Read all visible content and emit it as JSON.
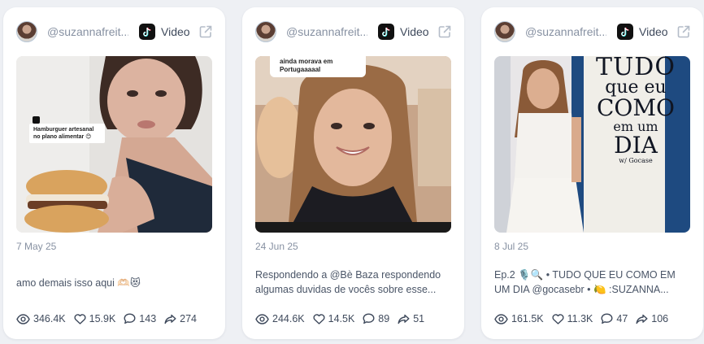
{
  "posts": [
    {
      "username": "@suzannafreit...",
      "platform": "Video",
      "date": "7 May 25",
      "description": "amo demais isso aqui 🫶🏻😻",
      "overlay_text": "Hamburguer artesanal no plano alimentar 😊",
      "stats": {
        "views": "346.4K",
        "likes": "15.9K",
        "comments": "143",
        "shares": "274"
      }
    },
    {
      "username": "@suzannafreit...",
      "platform": "Video",
      "date": "24 Jun 25",
      "description": "Respondendo a @Bè Baza respondendo algumas duvidas de vocês sobre esse...",
      "overlay_text": "ainda morava em Portugaaaaal",
      "stats": {
        "views": "244.6K",
        "likes": "14.5K",
        "comments": "89",
        "shares": "51"
      }
    },
    {
      "username": "@suzannafreit...",
      "platform": "Video",
      "date": "8 Jul 25",
      "description": "Ep.2 🎙️🔍 • TUDO QUE EU COMO EM UM DIA @gocasebr • 🍋 :SUZANNA...",
      "overlay_title": [
        "TUDO",
        "que eu",
        "COMO",
        "em um",
        "DIA",
        "w/ Gocase"
      ],
      "stats": {
        "views": "161.5K",
        "likes": "11.3K",
        "comments": "47",
        "shares": "106"
      }
    }
  ],
  "icons": {
    "avatar": "avatar",
    "platform": "tiktok-icon",
    "open": "external-link-icon",
    "views": "eye-icon",
    "likes": "heart-icon",
    "comments": "comment-icon",
    "shares": "share-icon"
  },
  "colors": {
    "background": "#eef0f4",
    "card": "#ffffff",
    "muted_text": "#8791a2",
    "text": "#3f4a5c"
  }
}
